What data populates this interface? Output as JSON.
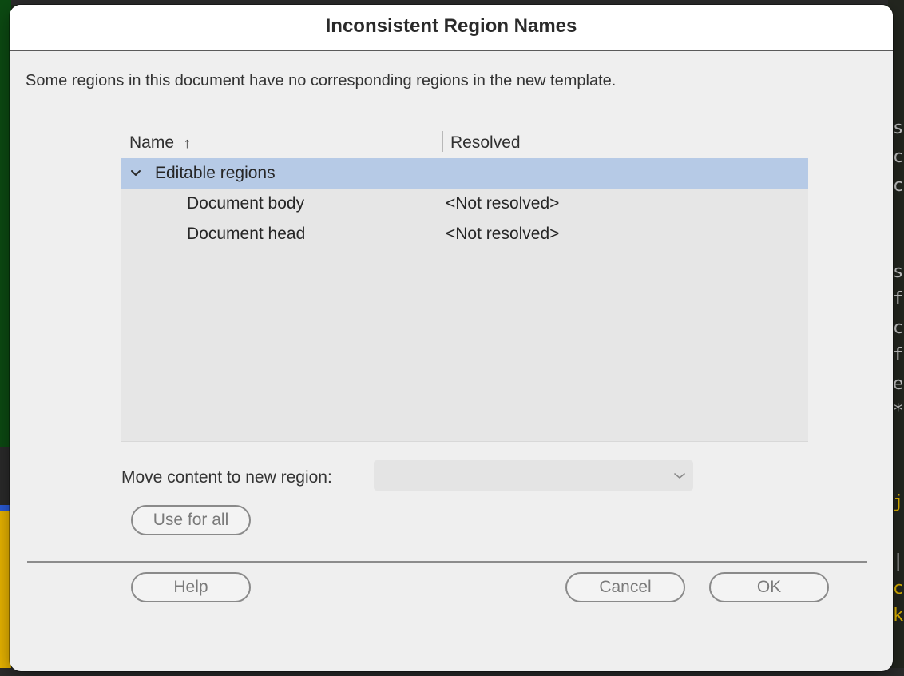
{
  "dialog": {
    "title": "Inconsistent Region Names",
    "message": "Some regions in this document have no corresponding regions in the new template."
  },
  "table": {
    "columns": {
      "name": "Name",
      "resolved": "Resolved"
    },
    "sort_icon": "arrow-up-icon",
    "group": {
      "label": "Editable regions",
      "expanded": true,
      "icon": "chevron-down-icon"
    },
    "rows": [
      {
        "name": "Document body",
        "resolved": "<Not resolved>"
      },
      {
        "name": "Document head",
        "resolved": "<Not resolved>"
      }
    ]
  },
  "move": {
    "label": "Move content to new region:",
    "selected_value": ""
  },
  "buttons": {
    "use_for_all": "Use for all",
    "help": "Help",
    "cancel": "Cancel",
    "ok": "OK"
  },
  "colors": {
    "selection": "#b6cae6",
    "dialog_background": "#efefef",
    "titlebar": "#ffffff"
  }
}
